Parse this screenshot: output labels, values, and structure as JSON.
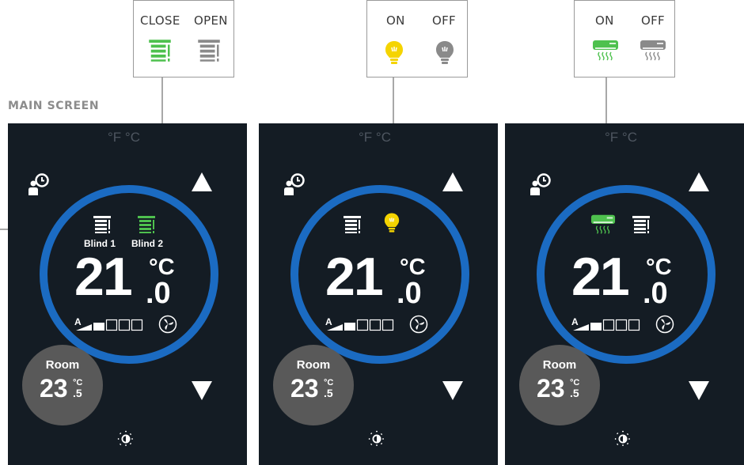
{
  "callouts": [
    {
      "labels": [
        "CLOSE",
        "OPEN"
      ],
      "active_color": "#4ec14e",
      "inactive_color": "#8a8a8a"
    },
    {
      "labels": [
        "ON",
        "OFF"
      ],
      "active_color": "#f5d400",
      "inactive_color": "#8a8a8a"
    },
    {
      "labels": [
        "ON",
        "OFF"
      ],
      "active_color": "#4ec14e",
      "inactive_color": "#8a8a8a"
    }
  ],
  "section_title": "MAIN SCREEN",
  "panels": [
    {
      "units": "°F °C",
      "setpoint_int": "21",
      "setpoint_unit": "°C",
      "setpoint_dec": ".0",
      "fan_auto": "A",
      "room_label": "Room",
      "room_int": "23",
      "room_unit": "°C",
      "room_dec": ".5",
      "blind_labels": [
        "Blind 1",
        "Blind 2"
      ]
    },
    {
      "units": "°F °C",
      "setpoint_int": "21",
      "setpoint_unit": "°C",
      "setpoint_dec": ".0",
      "fan_auto": "A",
      "room_label": "Room",
      "room_int": "23",
      "room_unit": "°C",
      "room_dec": ".5"
    },
    {
      "units": "°F °C",
      "setpoint_int": "21",
      "setpoint_unit": "°C",
      "setpoint_dec": ".0",
      "fan_auto": "A",
      "room_label": "Room",
      "room_int": "23",
      "room_unit": "°C",
      "room_dec": ".5"
    }
  ],
  "colors": {
    "panel_bg": "#141c24",
    "ring": "#1b6bc2",
    "green": "#4ec14e",
    "yellow": "#f5d400",
    "grey_icon": "#8a8a8a"
  },
  "fan_speed_level_of_5": 2
}
